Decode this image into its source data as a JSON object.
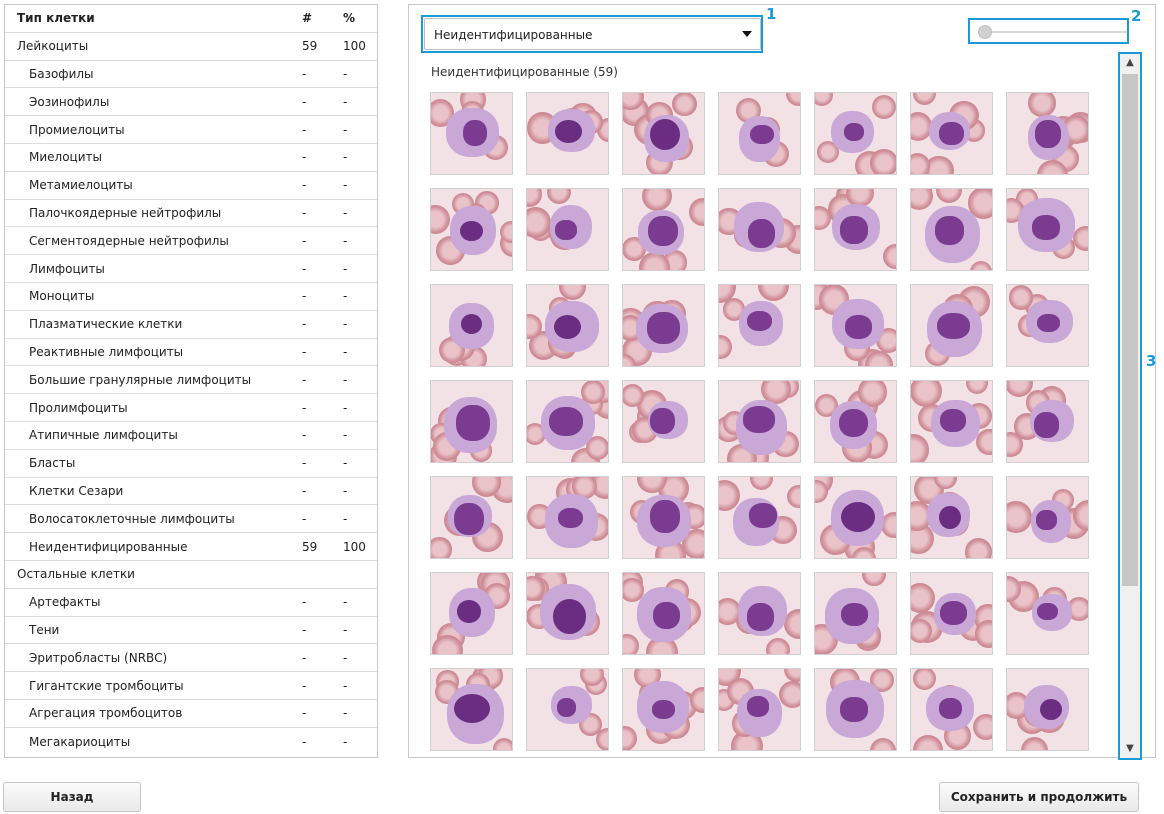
{
  "table": {
    "headers": {
      "name": "Тип клетки",
      "count": "#",
      "percent": "%"
    },
    "rows": [
      {
        "name": "Лейкоциты",
        "count": "59",
        "percent": "100",
        "sub": false
      },
      {
        "name": "Базофилы",
        "count": "-",
        "percent": "-",
        "sub": true
      },
      {
        "name": "Эозинофилы",
        "count": "-",
        "percent": "-",
        "sub": true
      },
      {
        "name": "Промиелоциты",
        "count": "-",
        "percent": "-",
        "sub": true
      },
      {
        "name": "Миелоциты",
        "count": "-",
        "percent": "-",
        "sub": true
      },
      {
        "name": "Метамиелоциты",
        "count": "-",
        "percent": "-",
        "sub": true
      },
      {
        "name": "Палочкоядерные нейтрофилы",
        "count": "-",
        "percent": "-",
        "sub": true
      },
      {
        "name": "Сегментоядерные нейтрофилы",
        "count": "-",
        "percent": "-",
        "sub": true
      },
      {
        "name": "Лимфоциты",
        "count": "-",
        "percent": "-",
        "sub": true
      },
      {
        "name": "Моноциты",
        "count": "-",
        "percent": "-",
        "sub": true
      },
      {
        "name": "Плазматические клетки",
        "count": "-",
        "percent": "-",
        "sub": true
      },
      {
        "name": "Реактивные лимфоциты",
        "count": "-",
        "percent": "-",
        "sub": true
      },
      {
        "name": "Большие гранулярные лимфоциты",
        "count": "-",
        "percent": "-",
        "sub": true
      },
      {
        "name": "Пролимфоциты",
        "count": "-",
        "percent": "-",
        "sub": true
      },
      {
        "name": "Атипичные лимфоциты",
        "count": "-",
        "percent": "-",
        "sub": true
      },
      {
        "name": "Бласты",
        "count": "-",
        "percent": "-",
        "sub": true
      },
      {
        "name": "Клетки Сезари",
        "count": "-",
        "percent": "-",
        "sub": true
      },
      {
        "name": "Волосатоклеточные лимфоциты",
        "count": "-",
        "percent": "-",
        "sub": true
      },
      {
        "name": "Неидентифицированные",
        "count": "59",
        "percent": "100",
        "sub": true
      },
      {
        "name": "Остальные клетки",
        "count": "",
        "percent": "",
        "sub": false
      },
      {
        "name": "Артефакты",
        "count": "-",
        "percent": "-",
        "sub": true
      },
      {
        "name": "Тени",
        "count": "-",
        "percent": "-",
        "sub": true
      },
      {
        "name": "Эритробласты (NRBC)",
        "count": "-",
        "percent": "-",
        "sub": true
      },
      {
        "name": "Гигантские тромбоциты",
        "count": "-",
        "percent": "-",
        "sub": true
      },
      {
        "name": "Агрегация тромбоцитов",
        "count": "-",
        "percent": "-",
        "sub": true
      },
      {
        "name": "Мегакариоциты",
        "count": "-",
        "percent": "-",
        "sub": true
      }
    ]
  },
  "gallery": {
    "dropdown_value": "Неидентифицированные",
    "group_label": "Неидентифицированные (59)",
    "visible_rows": 7,
    "visible_cols": 7,
    "zoom_level": 0.0
  },
  "annotations": {
    "dropdown": "1",
    "zoom_slider": "2",
    "scrollbar": "3"
  },
  "buttons": {
    "back": "Назад",
    "save": "Сохранить и продолжить"
  },
  "colors": {
    "accent": "#1a9bd7",
    "stain_light": "#c9a8d8",
    "stain_dark": "#7b3b90",
    "rbc": "#e9c3c8"
  },
  "icons": {
    "dropdown_caret": "chevron-down-icon",
    "scroll_up": "arrow-up-icon",
    "scroll_down": "arrow-down-icon"
  }
}
